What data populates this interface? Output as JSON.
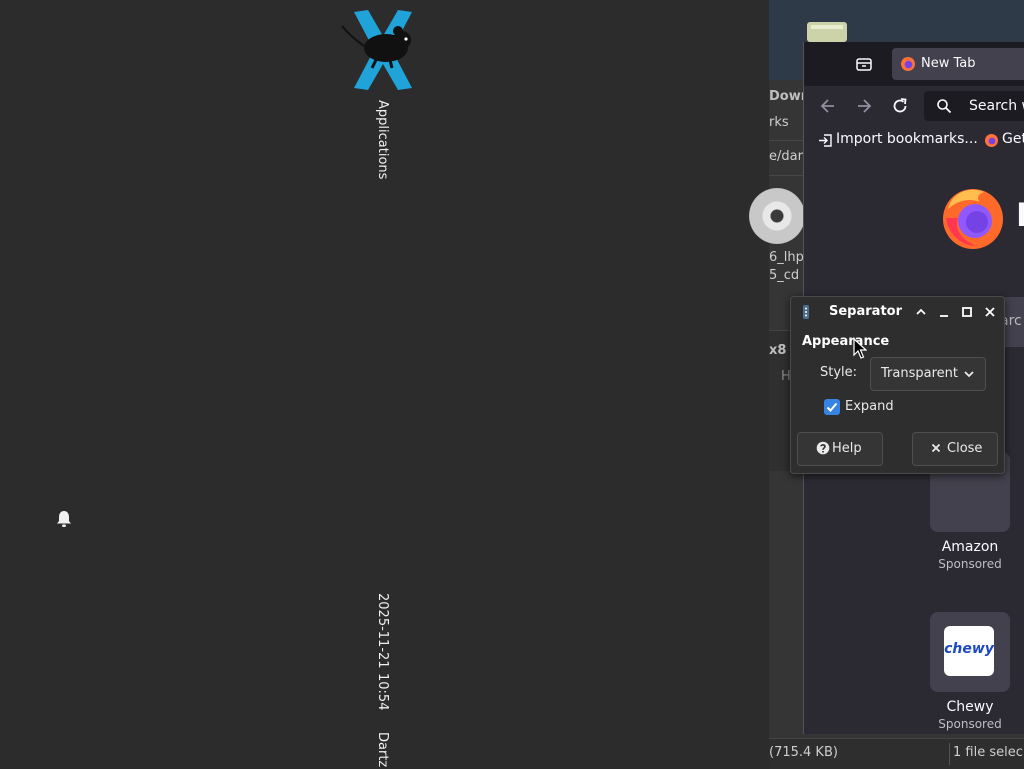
{
  "panel": {
    "applications_label": "Applications",
    "date": "2025-11-21",
    "time": "10:54",
    "user": "Dartz",
    "icons": {
      "app_menu": "xfce-mouse-logo",
      "notifications": "bell-icon"
    }
  },
  "file_manager": {
    "sidebar": [
      "Down",
      "rks"
    ],
    "path_fragment": "e/dart",
    "file_name_lines": [
      "6_lhp",
      "5_cd"
    ],
    "panel2_label": "x8",
    "panel2_sub": "H",
    "status_left": "(715.4 KB)",
    "status_right": "1 file selec"
  },
  "firefox": {
    "tab_title": "New Tab",
    "url_placeholder": "Search w",
    "bookmarks": [
      "Import bookmarks...",
      "Get"
    ],
    "search_fragment": "arc",
    "logo_letter": "F",
    "shortcuts": [
      {
        "name": "Amazon",
        "sub": "Sponsored"
      },
      {
        "name": "Chewy",
        "sub": "Sponsored",
        "logo_text": "chewy"
      }
    ],
    "colors": {
      "bg": "#2b2a33",
      "tabbar": "#1c1b22"
    }
  },
  "dialog": {
    "title": "Separator",
    "section": "Appearance",
    "style_label": "Style:",
    "style_value": "Transparent",
    "expand_label": "Expand",
    "expand_checked": true,
    "help_label": "Help",
    "close_label": "Close",
    "accent": "#3584e4"
  }
}
